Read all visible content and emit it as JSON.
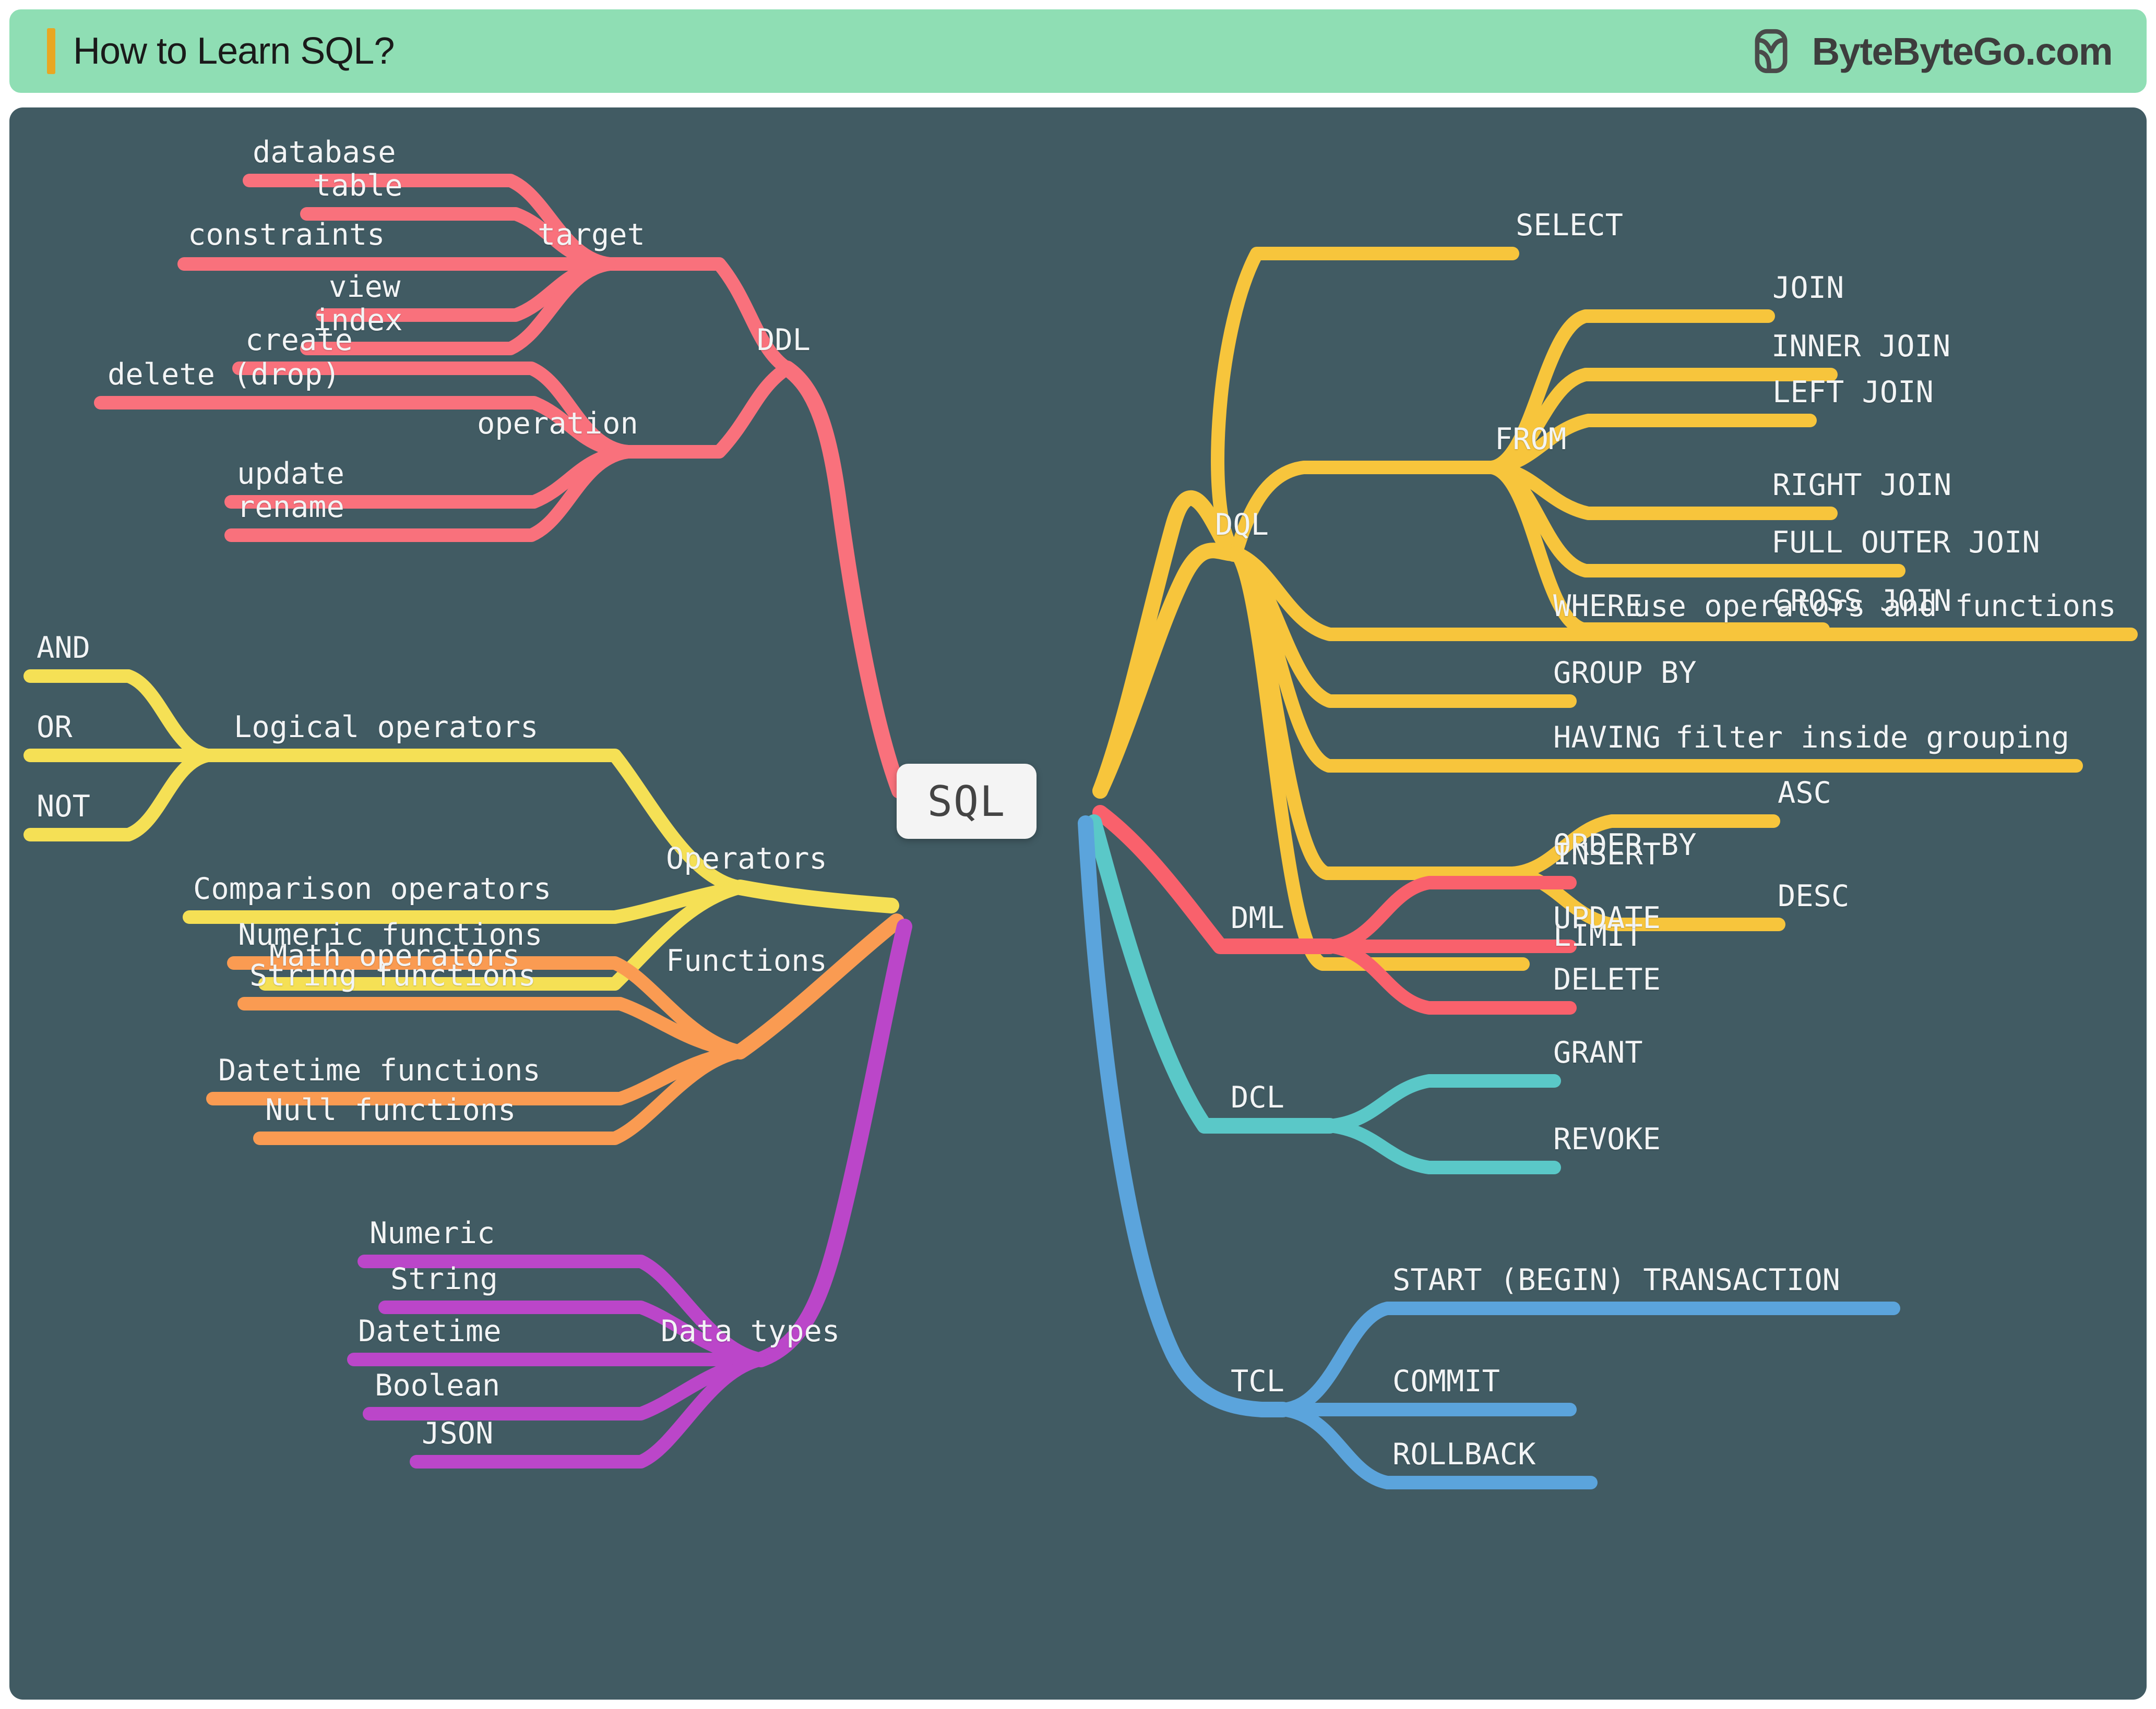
{
  "header": {
    "title": "How to Learn SQL?",
    "brand_name": "ByteByteGo.com",
    "accent_color": "#E8A723",
    "background_color": "#8FDEB4",
    "logo_icon": "bytebytego-logo-icon"
  },
  "canvas": {
    "background_color": "#415B63"
  },
  "root": {
    "label": "SQL"
  },
  "colors": {
    "ddl": "#F9717C",
    "dql": "#F7C53C",
    "operators": "#F5E055",
    "functions": "#FA9B52",
    "data_types": "#BB46C9",
    "dml": "#F9616C",
    "dcl": "#5AC8C8",
    "tcl": "#5BA4DC"
  },
  "branches": [
    {
      "id": "ddl",
      "label": "DDL",
      "color": "#F9717C",
      "side": "left",
      "groups": [
        {
          "label": "target",
          "children": [
            "database",
            "table",
            "constraints",
            "view",
            "index"
          ]
        },
        {
          "label": "operation",
          "children": [
            "create",
            "delete (drop)",
            "update",
            "rename"
          ]
        }
      ]
    },
    {
      "id": "operators",
      "label": "Operators",
      "color": "#F5E055",
      "side": "left",
      "groups": [
        {
          "label": "Logical operators",
          "children": [
            "AND",
            "OR",
            "NOT"
          ]
        },
        {
          "label": "Comparison operators",
          "children": []
        },
        {
          "label": "Math operators",
          "children": []
        }
      ]
    },
    {
      "id": "functions",
      "label": "Functions",
      "color": "#FA9B52",
      "side": "left",
      "groups": [
        {
          "label": "Numeric functions",
          "children": []
        },
        {
          "label": "String functions",
          "children": []
        },
        {
          "label": "Datetime functions",
          "children": []
        },
        {
          "label": "Null functions",
          "children": []
        }
      ]
    },
    {
      "id": "data-types",
      "label": "Data types",
      "color": "#BB46C9",
      "side": "left",
      "groups": [
        {
          "label": "Numeric",
          "children": []
        },
        {
          "label": "String",
          "children": []
        },
        {
          "label": "Datetime",
          "children": []
        },
        {
          "label": "Boolean",
          "children": []
        },
        {
          "label": "JSON",
          "children": []
        }
      ]
    },
    {
      "id": "dql",
      "label": "DQL",
      "color": "#F7C53C",
      "side": "right",
      "groups": [
        {
          "label": "SELECT",
          "children": []
        },
        {
          "label": "FROM",
          "children": [
            "JOIN",
            "INNER JOIN",
            "LEFT JOIN",
            "RIGHT JOIN",
            "FULL OUTER JOIN",
            "CROSS JOIN"
          ]
        },
        {
          "label": "WHERE",
          "note": "use operators and functions",
          "children": []
        },
        {
          "label": "GROUP BY",
          "children": []
        },
        {
          "label": "HAVING",
          "note": "filter inside grouping",
          "children": []
        },
        {
          "label": "ORDER BY",
          "children": [
            "ASC",
            "DESC"
          ]
        },
        {
          "label": "LIMIT",
          "children": []
        }
      ]
    },
    {
      "id": "dml",
      "label": "DML",
      "color": "#F9616C",
      "side": "right",
      "groups": [
        {
          "label": "INSERT",
          "children": []
        },
        {
          "label": "UPDATE",
          "children": []
        },
        {
          "label": "DELETE",
          "children": []
        }
      ]
    },
    {
      "id": "dcl",
      "label": "DCL",
      "color": "#5AC8C8",
      "side": "right",
      "groups": [
        {
          "label": "GRANT",
          "children": []
        },
        {
          "label": "REVOKE",
          "children": []
        }
      ]
    },
    {
      "id": "tcl",
      "label": "TCL",
      "color": "#5BA4DC",
      "side": "right",
      "groups": [
        {
          "label": "START (BEGIN) TRANSACTION",
          "children": []
        },
        {
          "label": "COMMIT",
          "children": []
        },
        {
          "label": "ROLLBACK",
          "children": []
        }
      ]
    }
  ],
  "labels": {
    "ddl": "DDL",
    "ddl_target": "target",
    "ddl_database": "database",
    "ddl_table": "table",
    "ddl_constraints": "constraints",
    "ddl_view": "view",
    "ddl_index": "index",
    "ddl_operation": "operation",
    "ddl_create": "create",
    "ddl_delete": "delete (drop)",
    "ddl_update": "update",
    "ddl_rename": "rename",
    "operators": "Operators",
    "op_logical": "Logical operators",
    "op_and": "AND",
    "op_or": "OR",
    "op_not": "NOT",
    "op_comparison": "Comparison operators",
    "op_math": "Math operators",
    "functions": "Functions",
    "fn_numeric": "Numeric functions",
    "fn_string": "String functions",
    "fn_datetime": "Datetime functions",
    "fn_null": "Null functions",
    "datatypes": "Data types",
    "dt_numeric": "Numeric",
    "dt_string": "String",
    "dt_datetime": "Datetime",
    "dt_boolean": "Boolean",
    "dt_json": "JSON",
    "dql": "DQL",
    "dql_select": "SELECT",
    "dql_from": "FROM",
    "dql_join": "JOIN",
    "dql_inner_join": "INNER JOIN",
    "dql_left_join": "LEFT JOIN",
    "dql_right_join": "RIGHT JOIN",
    "dql_full_outer_join": "FULL OUTER JOIN",
    "dql_cross_join": "CROSS JOIN",
    "dql_where": "WHERE",
    "dql_where_note": "use operators and functions",
    "dql_group_by": "GROUP BY",
    "dql_having": "HAVING",
    "dql_having_note": "filter inside grouping",
    "dql_order_by": "ORDER BY",
    "dql_asc": "ASC",
    "dql_desc": "DESC",
    "dql_limit": "LIMIT",
    "dml": "DML",
    "dml_insert": "INSERT",
    "dml_update": "UPDATE",
    "dml_delete": "DELETE",
    "dcl": "DCL",
    "dcl_grant": "GRANT",
    "dcl_revoke": "REVOKE",
    "tcl": "TCL",
    "tcl_start": "START (BEGIN) TRANSACTION",
    "tcl_commit": "COMMIT",
    "tcl_rollback": "ROLLBACK"
  }
}
